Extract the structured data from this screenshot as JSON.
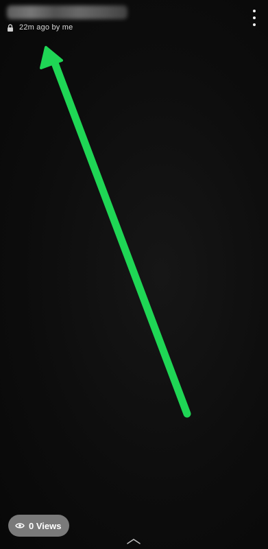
{
  "header": {
    "timestamp": "22m ago by me"
  },
  "views": {
    "label": "0 Views"
  },
  "icons": {
    "privacy": "lock-icon",
    "menu": "more-vertical-icon",
    "views": "eye-icon",
    "swipe": "chevron-up-icon"
  },
  "colors": {
    "background": "#0b0b0b",
    "arrow": "#1fd655",
    "pill": "#7a7a7a"
  }
}
